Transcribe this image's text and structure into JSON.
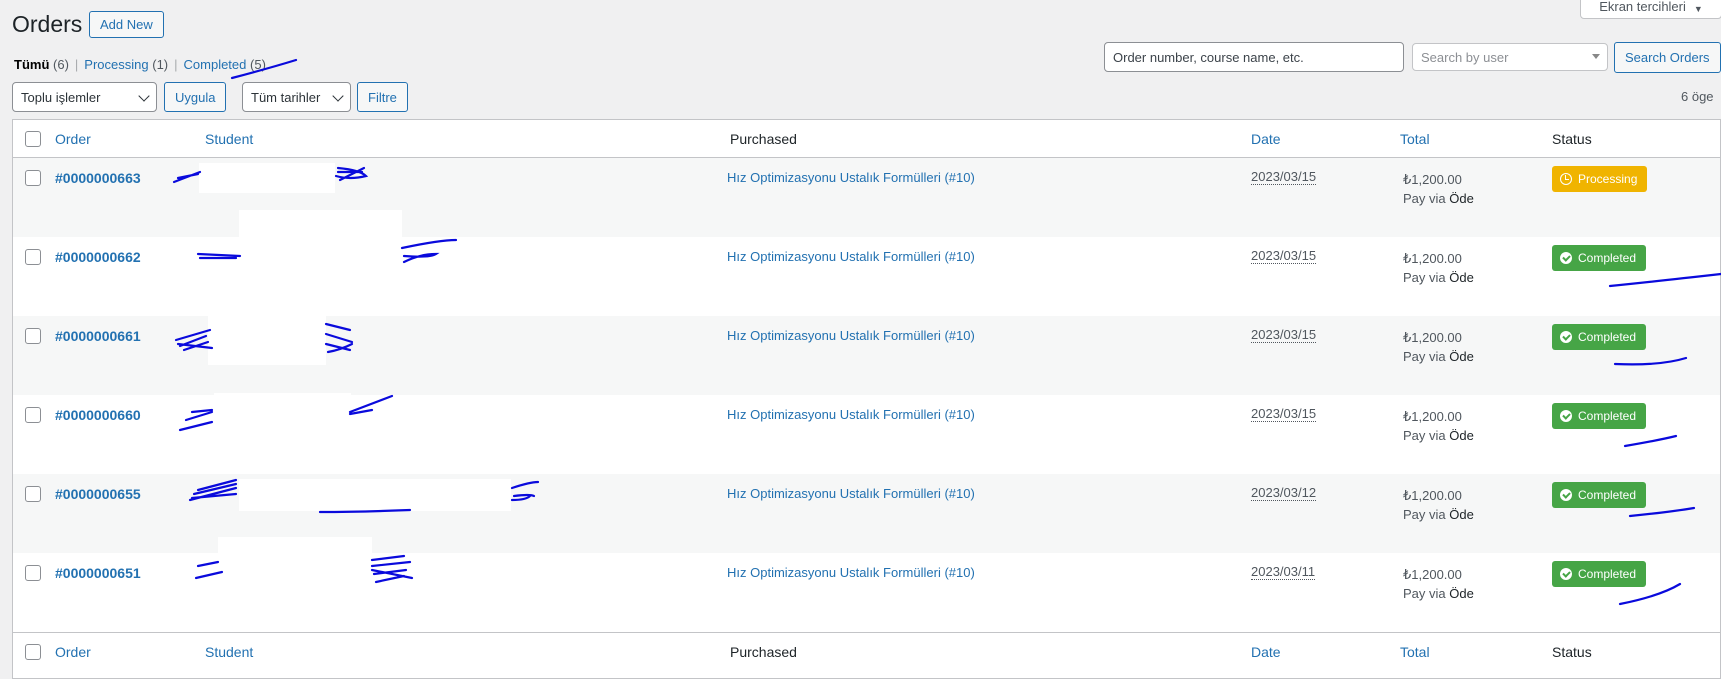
{
  "header": {
    "title": "Orders",
    "add_new": "Add New",
    "screen_options": "Ekran tercihleri"
  },
  "filters": [
    {
      "label": "Tümü",
      "count": "(6)"
    },
    {
      "label": "Processing",
      "count": "(1)"
    },
    {
      "label": "Completed",
      "count": "(5)"
    }
  ],
  "search": {
    "order_placeholder": "Order number, course name, etc.",
    "user_placeholder": "Search by user",
    "button": "Search Orders"
  },
  "toolbar": {
    "bulk_actions": "Toplu işlemler",
    "apply": "Uygula",
    "dates": "Tüm tarihler",
    "filter": "Filtre",
    "item_count": "6 öge"
  },
  "columns": {
    "order": "Order",
    "student": "Student",
    "purchased": "Purchased",
    "date": "Date",
    "total": "Total",
    "status": "Status"
  },
  "rows": [
    {
      "order": "#0000000663",
      "purchased": "Hız Optimizasyonu Ustalık Formülleri (#10)",
      "date": "2023/03/15",
      "amount": "₺1,200.00",
      "pay_prefix": "Pay via",
      "gateway": "Öde",
      "status": "Processing"
    },
    {
      "order": "#0000000662",
      "purchased": "Hız Optimizasyonu Ustalık Formülleri (#10)",
      "date": "2023/03/15",
      "amount": "₺1,200.00",
      "pay_prefix": "Pay via",
      "gateway": "Öde",
      "status": "Completed"
    },
    {
      "order": "#0000000661",
      "purchased": "Hız Optimizasyonu Ustalık Formülleri (#10)",
      "date": "2023/03/15",
      "amount": "₺1,200.00",
      "pay_prefix": "Pay via",
      "gateway": "Öde",
      "status": "Completed"
    },
    {
      "order": "#0000000660",
      "purchased": "Hız Optimizasyonu Ustalık Formülleri (#10)",
      "date": "2023/03/15",
      "amount": "₺1,200.00",
      "pay_prefix": "Pay via",
      "gateway": "Öde",
      "status": "Completed"
    },
    {
      "order": "#0000000655",
      "purchased": "Hız Optimizasyonu Ustalık Formülleri (#10)",
      "date": "2023/03/12",
      "amount": "₺1,200.00",
      "pay_prefix": "Pay via",
      "gateway": "Öde",
      "status": "Completed"
    },
    {
      "order": "#0000000651",
      "purchased": "Hız Optimizasyonu Ustalık Formülleri (#10)",
      "date": "2023/03/11",
      "amount": "₺1,200.00",
      "pay_prefix": "Pay via",
      "gateway": "Öde",
      "status": "Completed"
    }
  ],
  "colors": {
    "link": "#2271b1",
    "processing": "#f0b400",
    "completed": "#46a546",
    "scribble": "#0a0adc"
  }
}
